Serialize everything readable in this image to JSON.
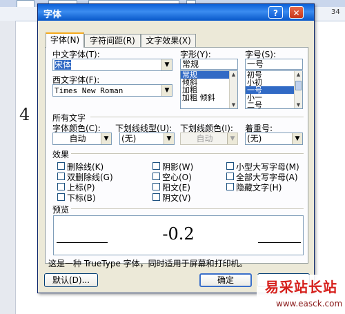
{
  "background": {
    "ruler_number": "34",
    "doc_text": "4"
  },
  "dialog": {
    "title": "字体",
    "help_glyph": "?",
    "close_glyph": "✕",
    "tabs": [
      {
        "label": "字体(N)",
        "active": true
      },
      {
        "label": "字符间距(R)",
        "active": false
      },
      {
        "label": "文字效果(X)",
        "active": false
      }
    ],
    "asian_font": {
      "label": "中文字体(T):",
      "value": "宋体"
    },
    "latin_font": {
      "label": "西文字体(F):",
      "value": "Times New Roman"
    },
    "font_style": {
      "label": "字形(Y):",
      "value": "常规",
      "items": [
        "常规",
        "倾斜",
        "加粗",
        "加粗 倾斜"
      ],
      "selected": "常规"
    },
    "font_size": {
      "label": "字号(S):",
      "value": "一号",
      "items": [
        "初号",
        "小初",
        "一号",
        "小一",
        "二号"
      ],
      "selected": "一号"
    },
    "all_text_section": "所有文字",
    "font_color": {
      "label": "字体颜色(C):",
      "value": "自动"
    },
    "underline_style": {
      "label": "下划线线型(U):",
      "value": "(无)"
    },
    "underline_color": {
      "label": "下划线颜色(I):",
      "value": "自动"
    },
    "emphasis_mark": {
      "label": "着重号:",
      "value": "(无)"
    },
    "effects_section": "效果",
    "effects": [
      {
        "label": "删除线(K)",
        "checked": false
      },
      {
        "label": "阴影(W)",
        "checked": false
      },
      {
        "label": "小型大写字母(M)",
        "checked": false
      },
      {
        "label": "双删除线(G)",
        "checked": false
      },
      {
        "label": "空心(O)",
        "checked": false
      },
      {
        "label": "全部大写字母(A)",
        "checked": false
      },
      {
        "label": "上标(P)",
        "checked": false
      },
      {
        "label": "阳文(E)",
        "checked": false
      },
      {
        "label": "隐藏文字(H)",
        "checked": false
      },
      {
        "label": "下标(B)",
        "checked": false
      },
      {
        "label": "阴文(V)",
        "checked": false
      }
    ],
    "preview_section": "预览",
    "preview_text": "-0.2",
    "description": "这是一种 TrueType 字体，同时适用于屏幕和打印机。",
    "default_button": "默认(D)...",
    "ok_button": "确定"
  },
  "watermark": {
    "text": "易采站长站",
    "url": "www.easck.com"
  }
}
